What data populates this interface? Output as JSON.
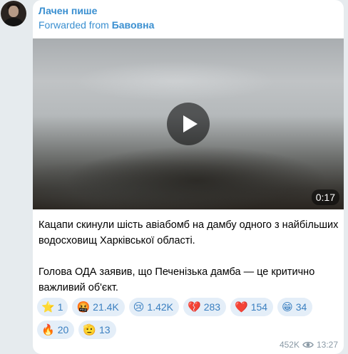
{
  "post": {
    "author": "Лачен пише",
    "forwarded_prefix": "Forwarded from",
    "forwarded_source": "Бавовна",
    "video_duration": "0:17",
    "text_paragraph_1": "Кацапи скинули шість авіабомб на дамбу одного з найбільших водосховищ Харківської області.",
    "text_paragraph_2": "Голова ОДА заявив, що Печенізька дамба — це критично важливий об'єкт.",
    "views": "452K",
    "time": "13:27"
  },
  "reactions": [
    {
      "emoji": "⭐",
      "count": "1"
    },
    {
      "emoji": "🤬",
      "count": "21.4K"
    },
    {
      "emoji": "😢",
      "count": "1.42K"
    },
    {
      "emoji": "💔",
      "count": "283"
    },
    {
      "emoji": "❤️",
      "count": "154"
    },
    {
      "emoji": "😁",
      "count": "34"
    },
    {
      "emoji": "🔥",
      "count": "20"
    },
    {
      "emoji": "🫡",
      "count": "13"
    }
  ],
  "icons": {
    "play": "play-icon",
    "views": "eye-icon"
  },
  "colors": {
    "link": "#3a8fd0",
    "reaction_bg": "#e4eef8",
    "reaction_text": "#3a7fc0",
    "meta": "#8b9aa6",
    "background": "#e6ebee"
  }
}
